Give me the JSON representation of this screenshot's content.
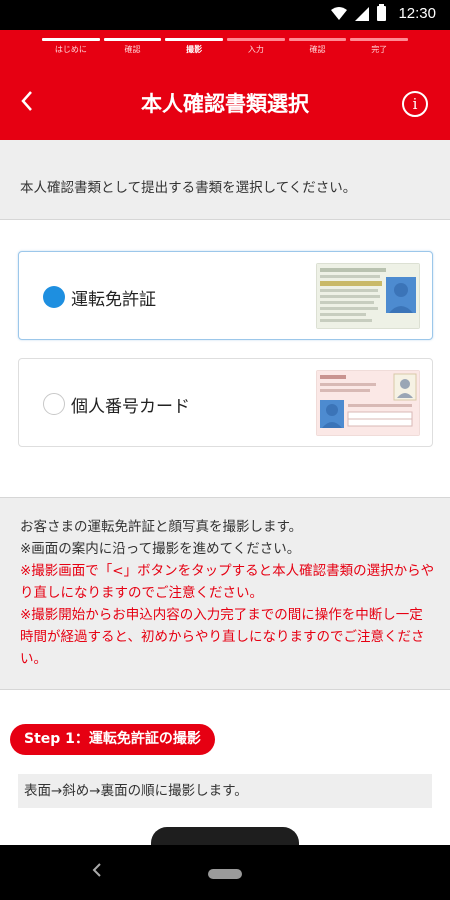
{
  "status_bar": {
    "time": "12:30"
  },
  "header": {
    "title": "本人確認書類選択",
    "steps": [
      {
        "label": "はじめに",
        "state": "done"
      },
      {
        "label": "確認",
        "state": "done"
      },
      {
        "label": "撮影",
        "state": "current"
      },
      {
        "label": "入力",
        "state": "todo"
      },
      {
        "label": "確認",
        "state": "todo"
      },
      {
        "label": "完了",
        "state": "todo"
      }
    ]
  },
  "instruction": "本人確認書類として提出する書類を選択してください。",
  "options": [
    {
      "label": "運転免許証",
      "selected": true
    },
    {
      "label": "個人番号カード",
      "selected": false
    }
  ],
  "note": {
    "line1": "お客さまの運転免許証と顔写真を撮影します。",
    "line2": "※画面の案内に沿って撮影を進めてください。",
    "warn1": "※撮影画面で「<」ボタンをタップすると本人確認書類の選択からやり直しになりますのでご注意ください。",
    "warn2": "※撮影開始からお申込内容の入力完了までの間に操作を中断し一定時間が経過すると、初めからやり直しになりますのでご注意ください。"
  },
  "step1": {
    "badge": "Step 1：運転免許証の撮影",
    "desc": "表面→斜め→裏面の順に撮影します。"
  },
  "colors": {
    "brand_red": "#e60012",
    "radio_blue": "#1e8fe0",
    "panel_gray": "#eeeeee"
  }
}
